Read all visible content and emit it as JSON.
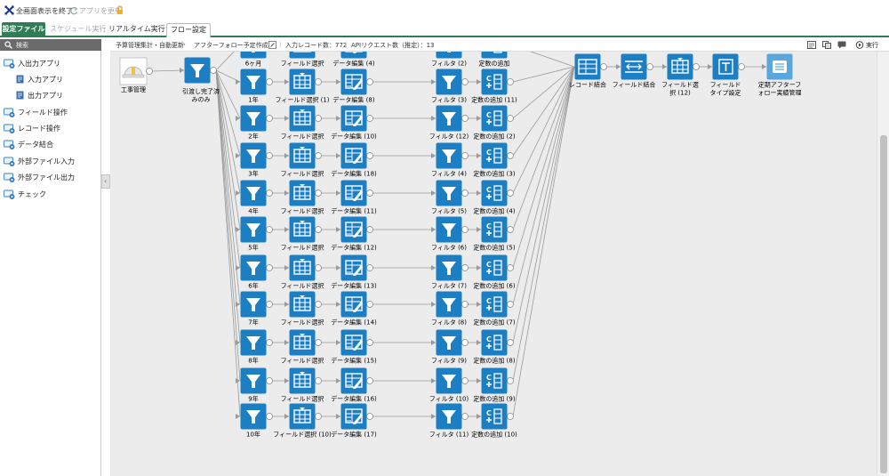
{
  "titlebar": {
    "exit_label": "全画面表示を終了",
    "update_label": "アプリを更新"
  },
  "tabs": [
    {
      "label": "設定ファイル",
      "state": "active"
    },
    {
      "label": "スケジュール実行",
      "state": "disabled"
    },
    {
      "label": "リアルタイム実行",
      "state": "normal"
    },
    {
      "label": "フロー設定",
      "state": "selected"
    }
  ],
  "sidebar": {
    "search_label": "検索",
    "items": [
      {
        "label": "入出力アプリ",
        "level": 0
      },
      {
        "label": "入力アプリ",
        "level": 1
      },
      {
        "label": "出力アプリ",
        "level": 1
      },
      {
        "label": "フィールド操作",
        "level": 0
      },
      {
        "label": "レコード操作",
        "level": 0
      },
      {
        "label": "データ結合",
        "level": 0
      },
      {
        "label": "外部ファイル入力",
        "level": 0
      },
      {
        "label": "外部ファイル出力",
        "level": 0
      },
      {
        "label": "チェック",
        "level": 0
      }
    ]
  },
  "breadcrumb": {
    "app": "予算管理集計・自動更新",
    "flow": "アフターフォロー予定作成",
    "input_records": "入力レコード数：772",
    "api_requests": "APIリクエスト数（推定）：13",
    "run_label": "実行"
  },
  "colors": {
    "node": "#1c7fc3",
    "node_last": "#5aa7dd",
    "accent_green": "#2e7d55"
  },
  "flow": {
    "source_label": "工事管理",
    "first_filter_label": "引渡し完了済みのみ",
    "rows": [
      {
        "filter": "6ヶ月",
        "select": "フィールド選択",
        "edit": "データ編集 (4)",
        "filter2": "フィルタ (2)",
        "add": "定数の追加"
      },
      {
        "filter": "1年",
        "select": "フィールド選択 (1)",
        "edit": "データ編集 (8)",
        "filter2": "フィルタ (3)",
        "add": "定数の追加 (11)"
      },
      {
        "filter": "2年",
        "select": "フィールド選択",
        "edit": "データ編集 (10)",
        "filter2": "フィルタ (12)",
        "add": "定数の追加 (2)"
      },
      {
        "filter": "3年",
        "select": "フィールド選択",
        "edit": "データ編集 (18)",
        "filter2": "フィルタ (4)",
        "add": "定数の追加 (3)"
      },
      {
        "filter": "4年",
        "select": "フィールド選択",
        "edit": "データ編集 (11)",
        "filter2": "フィルタ (5)",
        "add": "定数の追加 (4)"
      },
      {
        "filter": "5年",
        "select": "フィールド選択",
        "edit": "データ編集 (12)",
        "filter2": "フィルタ (6)",
        "add": "定数の追加 (5)"
      },
      {
        "filter": "6年",
        "select": "フィールド選択",
        "edit": "データ編集 (13)",
        "filter2": "フィルタ (7)",
        "add": "定数の追加 (6)"
      },
      {
        "filter": "7年",
        "select": "フィールド選択",
        "edit": "データ編集 (14)",
        "filter2": "フィルタ (8)",
        "add": "定数の追加 (7)"
      },
      {
        "filter": "8年",
        "select": "フィールド選択",
        "edit": "データ編集 (15)",
        "filter2": "フィルタ (9)",
        "add": "定数の追加 (8)"
      },
      {
        "filter": "9年",
        "select": "フィールド選択",
        "edit": "データ編集 (16)",
        "filter2": "フィルタ (10)",
        "add": "定数の追加 (9)"
      },
      {
        "filter": "10年",
        "select": "フィールド選択 (10)",
        "edit": "データ編集 (17)",
        "filter2": "フィルタ (11)",
        "add": "定数の追加 (10)"
      }
    ],
    "tail": [
      {
        "label": "レコード結合",
        "icon": "record-merge-icon"
      },
      {
        "label": "フィールド結合",
        "icon": "field-merge-icon"
      },
      {
        "label": "フィールド選択 (12)",
        "icon": "field-select-icon"
      },
      {
        "label": "フィールドタイプ設定",
        "icon": "field-type-icon"
      },
      {
        "label": "定期アフターフォロー実績管理",
        "icon": "output-app-icon"
      }
    ]
  }
}
